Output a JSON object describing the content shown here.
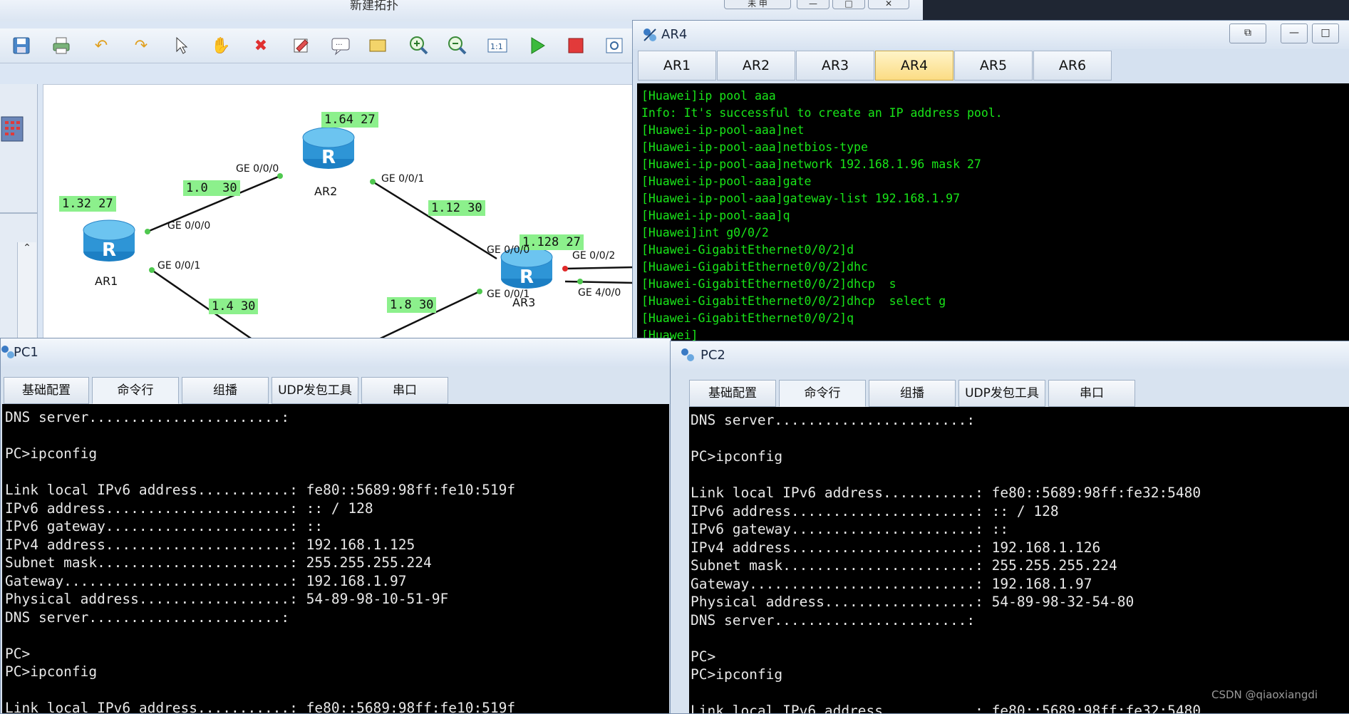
{
  "main_window": {
    "title": "新建拓扑",
    "window_controls": [
      "未 申",
      "—",
      "□",
      "✕"
    ],
    "toolbar_icons": [
      "save-icon",
      "print-icon",
      "undo-icon",
      "redo-icon",
      "pointer-icon",
      "hand-icon",
      "delete-icon",
      "eraser-icon",
      "text-icon",
      "rectangle-icon",
      "zoom-in-icon",
      "zoom-out-icon",
      "fit-icon",
      "start-icon",
      "stop-icon",
      "capture-icon"
    ]
  },
  "topology": {
    "devices": [
      "AR1",
      "AR2",
      "AR3"
    ],
    "subnets": [
      "1.32 27",
      "1.64 27",
      "1.0  30",
      "1.12 30",
      "1.128 27",
      "1.4 30",
      "1.8 30"
    ],
    "ports": [
      "GE 0/0/0",
      "GE 0/0/1",
      "GE 0/0/0",
      "GE 0/0/1",
      "GE 0/0/0",
      "GE 0/0/2",
      "GE 0/0/1",
      "GE 4/0/0"
    ],
    "colors": {
      "subnet_bg": "#8cf08c",
      "router": "#3aa0dc"
    }
  },
  "ar4": {
    "title": "AR4",
    "tabs": [
      "AR1",
      "AR2",
      "AR3",
      "AR4",
      "AR5",
      "AR6"
    ],
    "active_tab": "AR4",
    "console": [
      "[Huawei]ip pool aaa",
      "Info: It's successful to create an IP address pool.",
      "[Huawei-ip-pool-aaa]net",
      "[Huawei-ip-pool-aaa]netbios-type",
      "[Huawei-ip-pool-aaa]network 192.168.1.96 mask 27",
      "[Huawei-ip-pool-aaa]gate",
      "[Huawei-ip-pool-aaa]gateway-list 192.168.1.97",
      "[Huawei-ip-pool-aaa]q",
      "[Huawei]int g0/0/2",
      "[Huawei-GigabitEthernet0/0/2]d",
      "[Huawei-GigabitEthernet0/0/2]dhc",
      "[Huawei-GigabitEthernet0/0/2]dhcp  s",
      "[Huawei-GigabitEthernet0/0/2]dhcp  select g",
      "[Huawei-GigabitEthernet0/0/2]q",
      "[Huawei]"
    ]
  },
  "pc1": {
    "title": "PC1",
    "tabs": [
      "基础配置",
      "命令行",
      "组播",
      "UDP发包工具",
      "串口"
    ],
    "active_tab": "命令行",
    "console": [
      "DNS server.......................:",
      "",
      "PC>ipconfig",
      "",
      "Link local IPv6 address...........: fe80::5689:98ff:fe10:519f",
      "IPv6 address......................: :: / 128",
      "IPv6 gateway......................: ::",
      "IPv4 address......................: 192.168.1.125",
      "Subnet mask.......................: 255.255.255.224",
      "Gateway...........................: 192.168.1.97",
      "Physical address..................: 54-89-98-10-51-9F",
      "DNS server.......................:",
      "",
      "PC>",
      "PC>ipconfig",
      "",
      "Link local IPv6 address...........: fe80::5689:98ff:fe10:519f"
    ]
  },
  "pc2": {
    "title": "PC2",
    "tabs": [
      "基础配置",
      "命令行",
      "组播",
      "UDP发包工具",
      "串口"
    ],
    "active_tab": "命令行",
    "console": [
      "DNS server.......................:",
      "",
      "PC>ipconfig",
      "",
      "Link local IPv6 address...........: fe80::5689:98ff:fe32:5480",
      "IPv6 address......................: :: / 128",
      "IPv6 gateway......................: ::",
      "IPv4 address......................: 192.168.1.126",
      "Subnet mask.......................: 255.255.255.224",
      "Gateway...........................: 192.168.1.97",
      "Physical address..................: 54-89-98-32-54-80",
      "DNS server.......................:",
      "",
      "PC>",
      "PC>ipconfig",
      "",
      "Link local IPv6 address...........: fe80::5689:98ff:fe32:5480"
    ]
  },
  "watermark": "CSDN @qiaoxiangdi"
}
